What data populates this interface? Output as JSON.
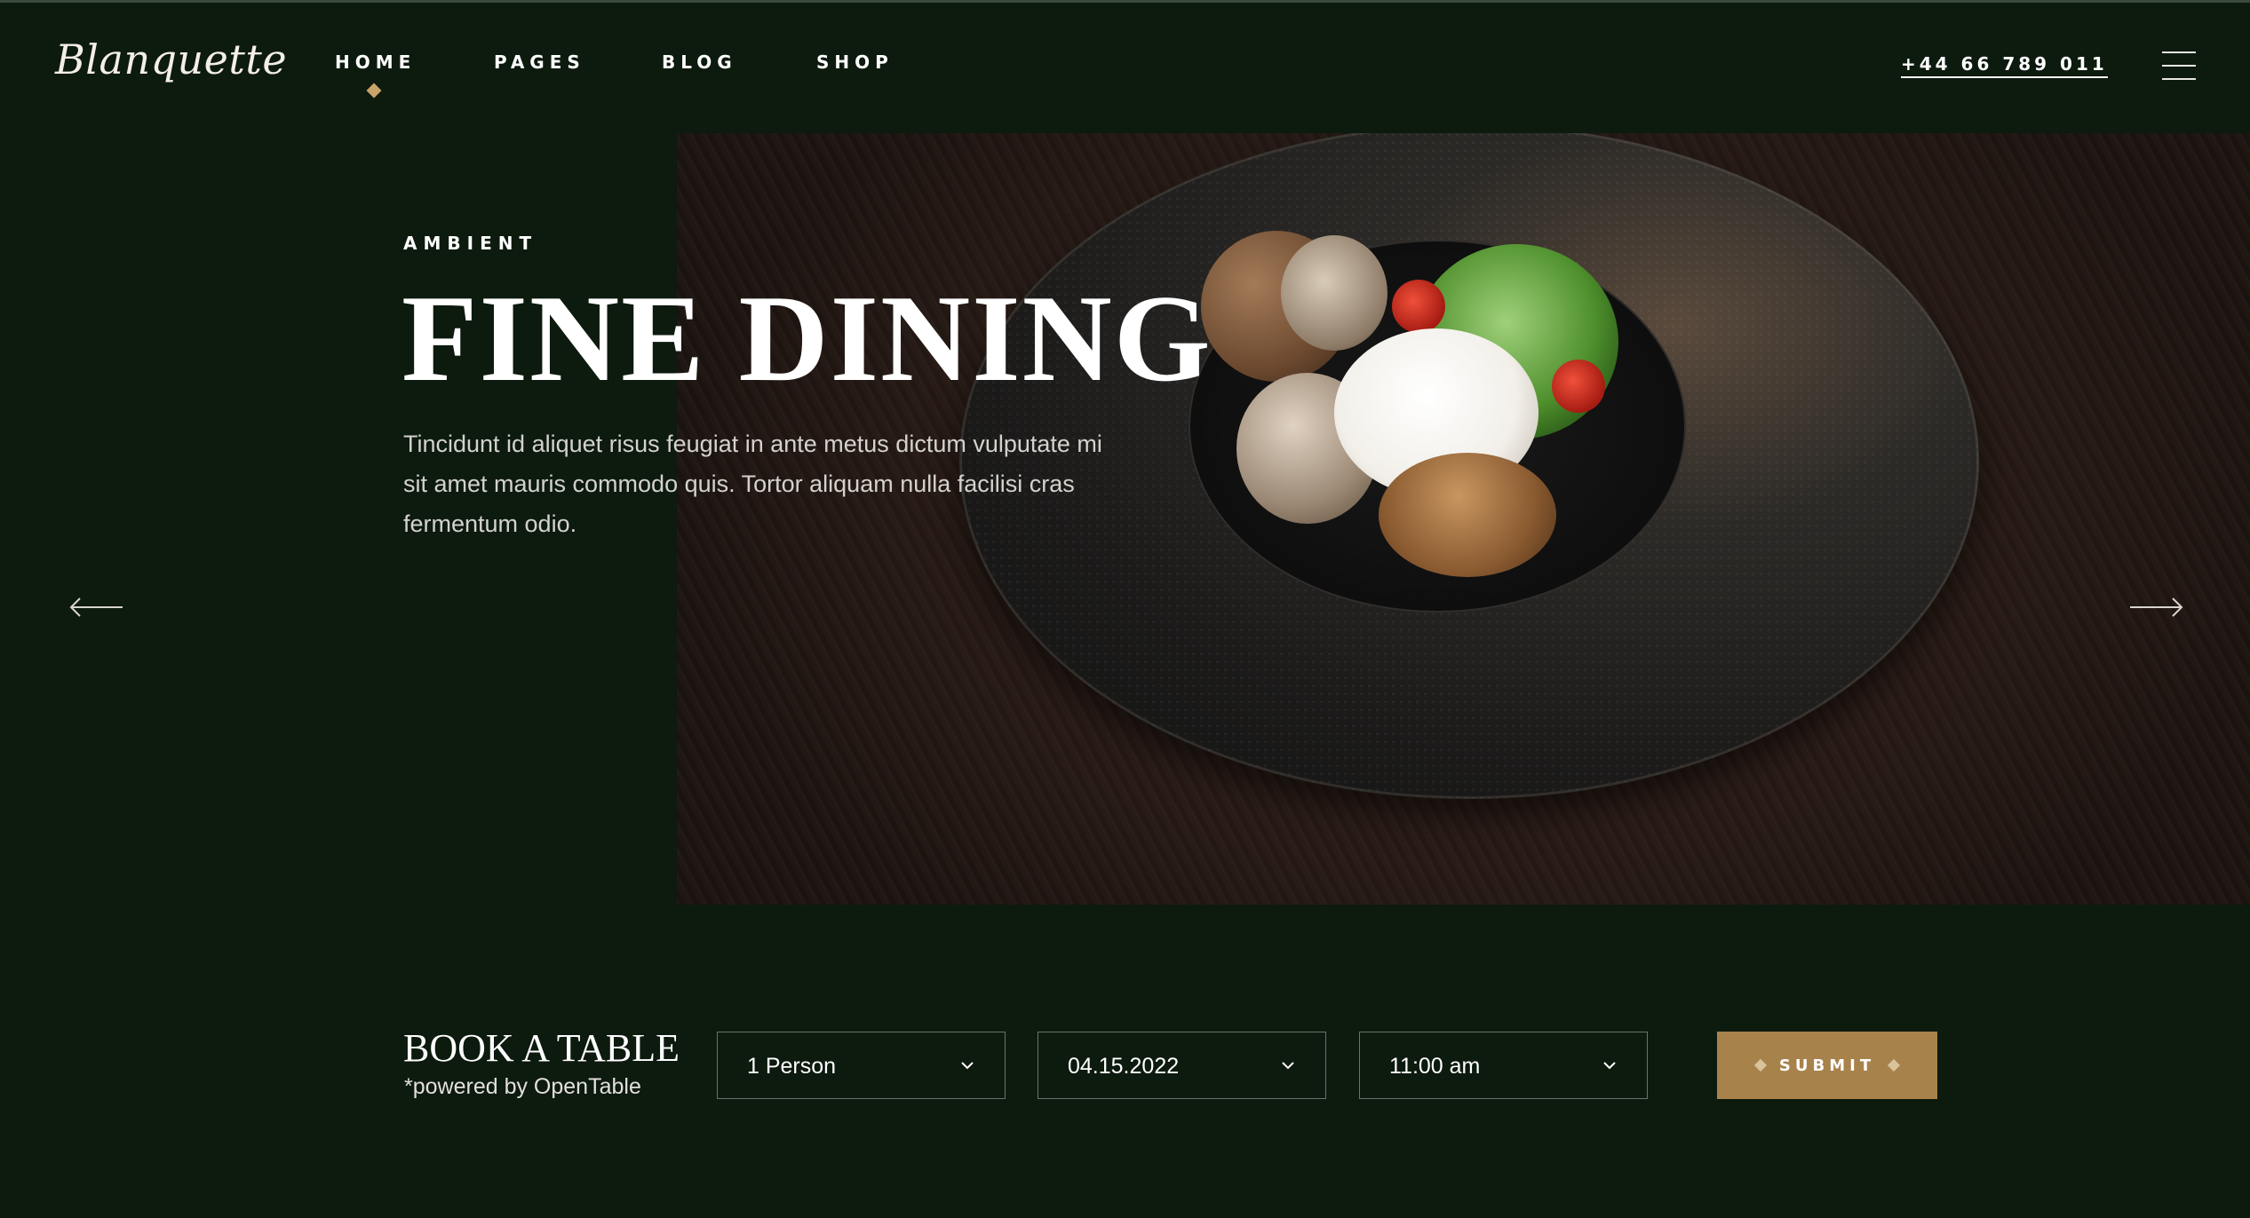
{
  "brand": {
    "logo": "Blanquette"
  },
  "nav": {
    "items": [
      {
        "label": "HOME",
        "active": true
      },
      {
        "label": "PAGES"
      },
      {
        "label": "BLOG"
      },
      {
        "label": "SHOP"
      }
    ],
    "phone": "+44 66 789 011",
    "menu_icon": "hamburger-icon"
  },
  "hero": {
    "eyebrow": "AMBIENT",
    "title": "FINE DINING",
    "description": "Tincidunt id aliquet risus feugiat in ante metus dictum vulputate mi sit amet mauris commodo quis. Tortor aliquam nulla facilisi cras fermentum odio.",
    "prev_icon": "arrow-left-icon",
    "next_icon": "arrow-right-icon"
  },
  "booking": {
    "title": "BOOK A TABLE",
    "subtitle": "*powered by OpenTable",
    "persons": "1 Person",
    "date": "04.15.2022",
    "time": "11:00 am",
    "submit": "SUBMIT"
  },
  "colors": {
    "background": "#0d1a0e",
    "accent": "#a8824b",
    "accent_light": "#c9a46a"
  }
}
